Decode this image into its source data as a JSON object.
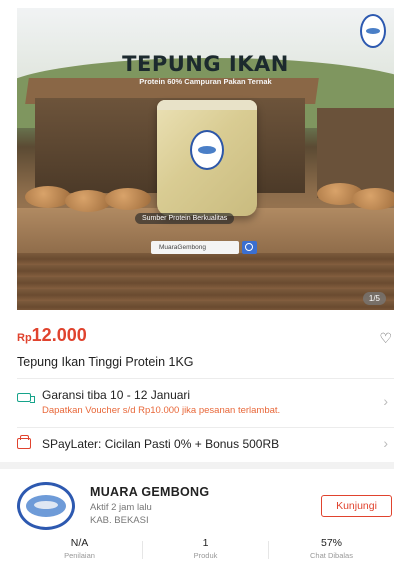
{
  "hero": {
    "title": "TEPUNG IKAN",
    "subtitle": "Protein 60% Campuran Pakan Ternak",
    "tag": "Sumber Protein Berkualitas",
    "search_text": "MuaraGembong",
    "pager": "1/5"
  },
  "product": {
    "currency": "Rp",
    "price": "12.000",
    "name": "Tepung Ikan Tinggi Protein 1KG"
  },
  "shipping": {
    "title": "Garansi tiba 10 - 12 Januari",
    "note": "Dapatkan Voucher s/d Rp10.000 jika pesanan terlambat."
  },
  "paylater": {
    "title": "SPayLater: Cicilan Pasti 0% + Bonus 500RB"
  },
  "shop": {
    "name": "MUARA GEMBONG",
    "active": "Aktif 2 jam lalu",
    "location": "KAB. BEKASI",
    "visit_label": "Kunjungi",
    "stats": [
      {
        "value": "N/A",
        "label": "Penilaian"
      },
      {
        "value": "1",
        "label": "Produk"
      },
      {
        "value": "57%",
        "label": "Chat Dibalas"
      }
    ]
  },
  "icons": {
    "wishlist": "heart-icon",
    "shipping": "truck-icon",
    "paylater": "wallet-icon",
    "chevron": "chevron-right-icon"
  },
  "colors": {
    "accent": "#e0432e",
    "shipping": "#16a38a"
  }
}
